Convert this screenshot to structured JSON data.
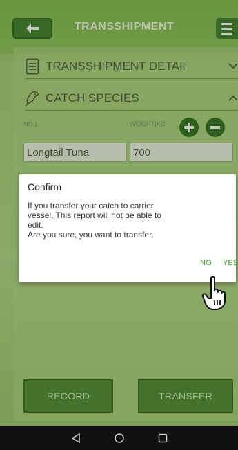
{
  "header": {
    "title": "TRANSSHIPMENT",
    "back_icon": "back-arrow-icon",
    "menu_icon": "hamburger-menu-icon"
  },
  "sections": [
    {
      "label": "TRANSSHIPMENT DETAIl",
      "icon": "document-icon",
      "chevron": "chevron-down-icon"
    },
    {
      "label": "CATCH SPECIES",
      "icon": "fish-icon",
      "chevron": "chevron-up-icon"
    }
  ],
  "catch_form": {
    "no_label": "NO.1",
    "weight_label": "WEIGHT(KG",
    "species_value": "Longtail Tuna",
    "weight_value": "700"
  },
  "dialog": {
    "title": "Confirm",
    "message_lines": [
      "If you transfer your catch to carrier",
      "vessel, This report will not be able to",
      "edit.",
      "Are you sure, you want to transfer."
    ],
    "no_label": "NO",
    "yes_label": "YES"
  },
  "actions": {
    "record_label": "RECORD",
    "transfer_label": "TRANSFER"
  },
  "nav": {
    "back": "nav-back-icon",
    "home": "nav-home-icon",
    "recents": "nav-recents-icon"
  },
  "colors": {
    "accent": "#3f7d2a",
    "dialog_button": "#3d9a2a",
    "panel": "#b2d686"
  }
}
